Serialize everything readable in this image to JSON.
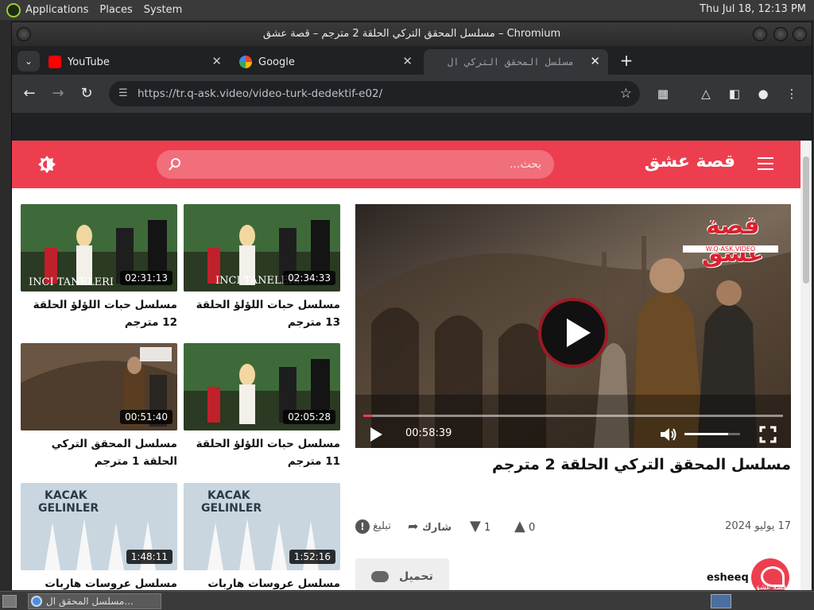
{
  "desktop": {
    "menus": [
      "Applications",
      "Places",
      "System"
    ],
    "clock": "Thu Jul 18, 12:13 PM",
    "taskbar_item": "مسلسل المحقق ال..."
  },
  "window": {
    "title": "مسلسل المحقق التركي الحلقة 2 مترجم – قصة عشق – Chromium"
  },
  "tabs": [
    {
      "label": "YouTube",
      "favicon": "youtube-icon"
    },
    {
      "label": "Google",
      "favicon": "google-icon"
    },
    {
      "label": "مسلسل المحقق التركي ال",
      "favicon": "none",
      "active": true
    }
  ],
  "toolbar": {
    "url": "https://tr.q-ask.video/video-turk-dedektif-e02/"
  },
  "site": {
    "logo": "قصة عشق",
    "search_placeholder": "بحث...",
    "accent": "#ec3e4f"
  },
  "player": {
    "time": "00:58:39",
    "progress": 0.02,
    "volume": 0.78,
    "watermark": "قصة عشق",
    "watermark_sub": "W.Q-ASK.VIDEO"
  },
  "video": {
    "title": "مسلسل المحقق التركي الحلقة 2 مترجم",
    "date": "17 يوليو 2024",
    "likes": "0",
    "dislikes": "1",
    "share": "شارك",
    "report": "تبليغ",
    "download": "تحميل",
    "channel": "esheeq",
    "channel_avatar_text": "قصة عشق"
  },
  "related": [
    {
      "title": "مسلسل حبات اللؤلؤ الحلقة 13 مترجم",
      "duration": "02:34:33"
    },
    {
      "title": "مسلسل حبات اللؤلؤ الحلقة 12 مترجم",
      "duration": "02:31:13"
    },
    {
      "title": "مسلسل حبات اللؤلؤ الحلقة 11 مترجم",
      "duration": "02:05:28"
    },
    {
      "title": "مسلسل المحقق التركي الحلقة 1 مترجم",
      "duration": "00:51:40"
    },
    {
      "title": "مسلسل عروسات هاربات",
      "duration": "1:52:16"
    },
    {
      "title": "مسلسل عروسات هاربات",
      "duration": "1:48:11"
    }
  ]
}
